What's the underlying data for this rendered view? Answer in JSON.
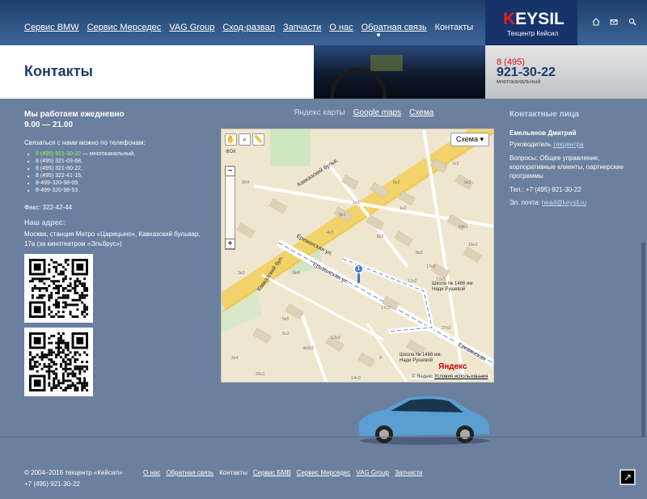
{
  "nav": {
    "items": [
      "Сервис BMW",
      "Сервис Мерседес",
      "VAG Group",
      "Сход-развал",
      "Запчасти",
      "О нас",
      "Обратная связь",
      "Контакты"
    ],
    "current": "Контакты"
  },
  "logo": {
    "k": "K",
    "rest": "EYSIL",
    "subtitle": "Техцентр Кейсил"
  },
  "top_icons": [
    "home-icon",
    "mail-icon",
    "search-icon"
  ],
  "header": {
    "title": "Контакты",
    "phone_code": "8 (495)",
    "phone_number": "921-30-22",
    "phone_note": "многоканальный"
  },
  "left": {
    "hours_title": "Мы работаем ежедневно",
    "hours_time": "9.00 — 21.00",
    "contact_intro": "Связаться с нами можно по телефонам:",
    "phones_first": "8 (495) 921-30-22",
    "phones_first_note": " — многоканальный,",
    "phones": [
      "8 (495) 321-03-68,",
      "8 (495) 321-80-22,",
      "8 (495) 322-41-15,",
      "8-499-320-98-09,",
      "8-499-320-98-53."
    ],
    "fax": "Факс: 322-42-44",
    "address_title": "Наш адрес:",
    "address": "Москва, станция Метро «Царицыно», Кавказский бульвар, 17а (за кинотеатром «Эльбрус»)"
  },
  "map": {
    "tabs": [
      "Яндекс карты",
      "Google maps",
      "Схема"
    ],
    "active_tab": "Яндекс карты",
    "type_selector": "Схема ▾",
    "label_fok": "ФОК",
    "street1": "Кавказский бул.",
    "street2": "Кавказский бульв.",
    "street3": "Ереванская ул.",
    "street4": "Ереванская ул.",
    "street5": "Ереванская",
    "school1": "Школа № 1466 им. Нади Рушевой",
    "school2": "Школа № 1466 им. Нади Рушевой",
    "marker_num": "1",
    "yandex": "Яндекс",
    "copyright": "© Яндекс",
    "terms": "Условия использования",
    "buildings": [
      "904",
      "6к2",
      "6к3",
      "5к1",
      "1к3",
      "8к2",
      "19к1",
      "1к2",
      "4к3",
      "17к3",
      "15к2",
      "8к3",
      "7к2",
      "17к1",
      "17к2",
      "6к4",
      "5к5",
      "17с2",
      "27к2",
      "4к3с2",
      "3к2",
      "2к4",
      "5с2",
      "14с2",
      "26к1",
      "12к3",
      "8"
    ]
  },
  "right": {
    "title": "Контактные лица",
    "name": "Емельянов Дмитрий",
    "role_prefix": "Руководитель ",
    "role_link": "техцентра",
    "questions": "Вопросы: Общее управление, корпоративные клиенты, партнерские программы",
    "tel": "Тел.: +7 (495) 921-30-22",
    "mail_prefix": "Эл. почта: ",
    "mail": "head@keysil.ru"
  },
  "footer": {
    "copyright": "© 2004–2016 техцентр «Кейсил»",
    "phone": "+7 (495) 921-30-22",
    "nav": [
      "О нас",
      "Обратная связь",
      "Контакты",
      "Сервис БМВ",
      "Сервис Мерседес",
      "VAG Group",
      "Запчасти"
    ],
    "current": "Контакты"
  },
  "colors": {
    "bg": "#6b7f9e",
    "nav": "#2f5584",
    "brand_red": "#e02020",
    "link_light": "#c4dbff",
    "green_phone": "#9aff5a"
  }
}
